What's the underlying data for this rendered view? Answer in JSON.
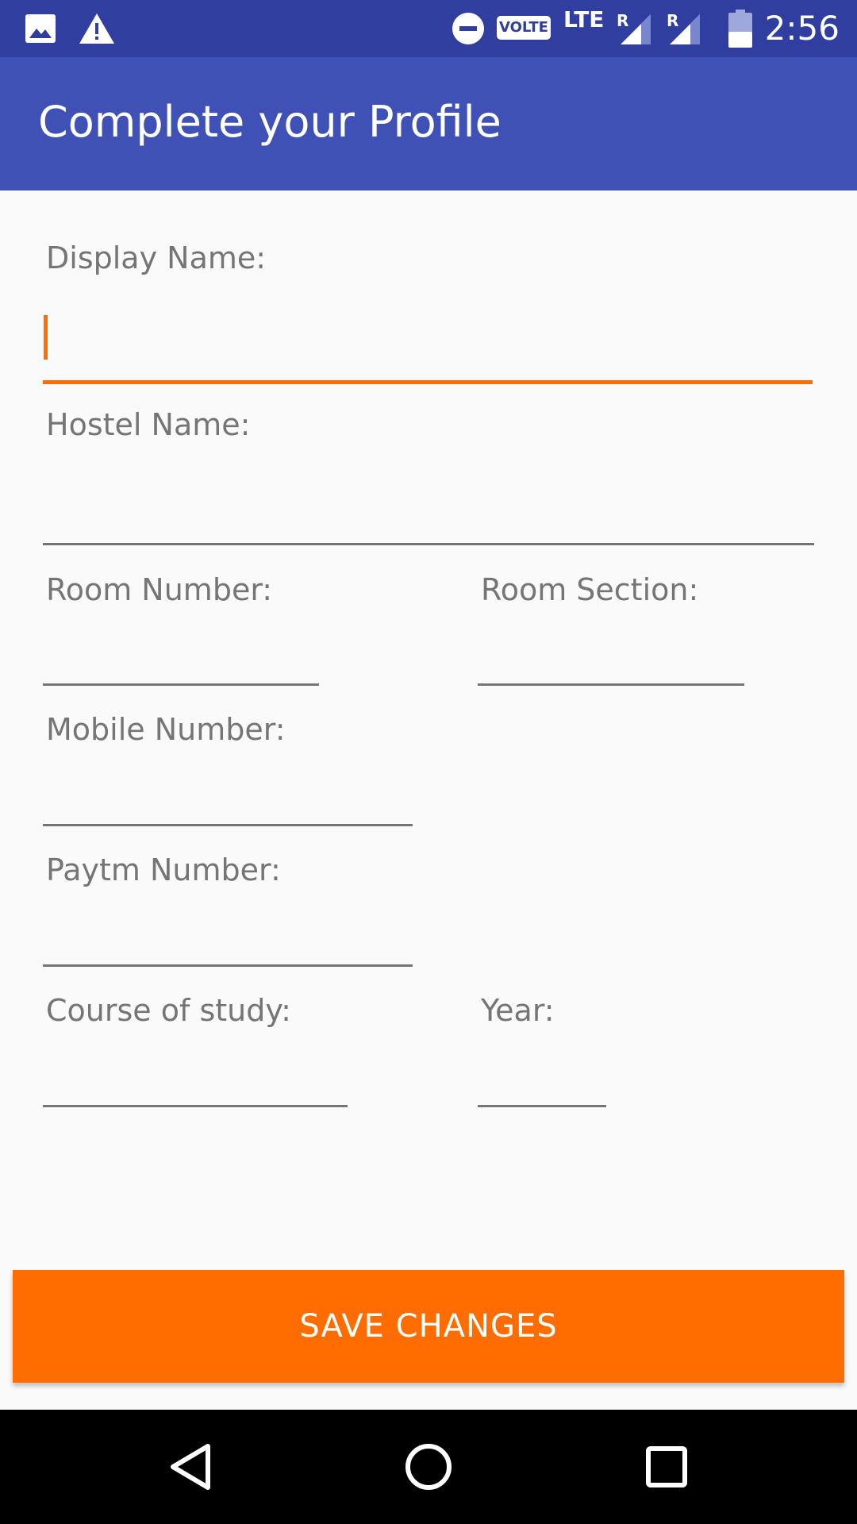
{
  "status_bar": {
    "time": "2:56",
    "volte": "VOLTE",
    "network": "LTE",
    "roaming_1": "R",
    "roaming_2": "R",
    "icons": [
      "image-icon",
      "warning-icon",
      "do-not-disturb-icon",
      "signal-icon",
      "signal-icon",
      "battery-icon"
    ]
  },
  "app_bar": {
    "title": "Complete your Profile"
  },
  "form": {
    "display_name": {
      "label": "Display Name:",
      "value": ""
    },
    "hostel_name": {
      "label": "Hostel Name:",
      "value": ""
    },
    "room_number": {
      "label": "Room Number:",
      "value": ""
    },
    "room_section": {
      "label": "Room Section:",
      "value": ""
    },
    "mobile_number": {
      "label": "Mobile Number:",
      "value": ""
    },
    "paytm_number": {
      "label": "Paytm Number:",
      "value": ""
    },
    "course_of_study": {
      "label": "Course of study:",
      "value": ""
    },
    "year": {
      "label": "Year:",
      "value": ""
    }
  },
  "save_button": {
    "label": "SAVE CHANGES"
  },
  "colors": {
    "status_bar": "#303f9f",
    "app_bar": "#3f51b5",
    "accent": "#ff6d00",
    "background": "#fafafa",
    "label": "#757575"
  },
  "nav_bar": {
    "icons": [
      "back-icon",
      "home-icon",
      "recents-icon"
    ]
  }
}
